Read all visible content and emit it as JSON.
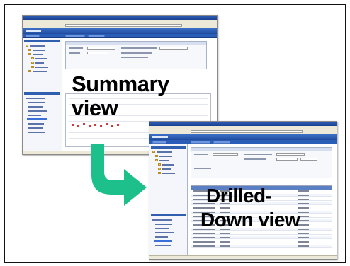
{
  "slide": {
    "labels": {
      "summary_line1": "Summary",
      "summary_line2": "view",
      "drilled_line1": "Drilled-",
      "drilled_line2": "Down view"
    }
  },
  "colors": {
    "arrow": "#1dbf8a",
    "window_header": "#2a5db8",
    "text": "#000000"
  },
  "icons": {
    "transition": "curved-arrow-icon"
  }
}
